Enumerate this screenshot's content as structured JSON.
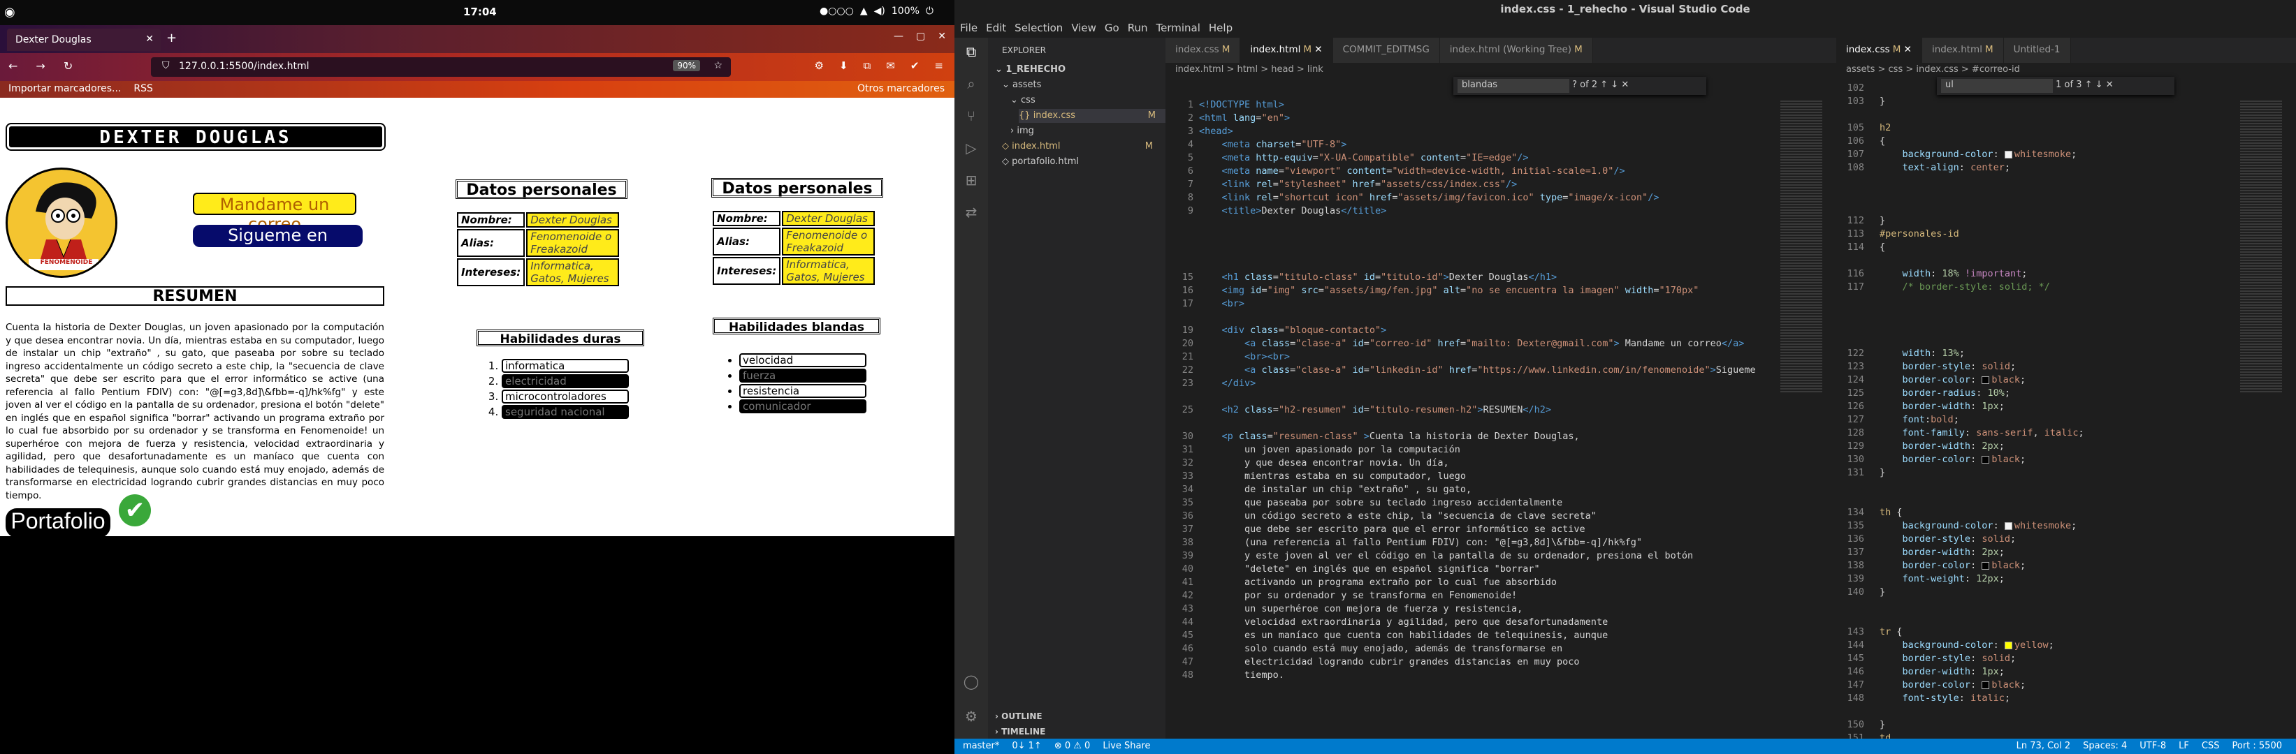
{
  "system": {
    "clock": "17:04",
    "battery": "100%"
  },
  "firefox": {
    "tab_title": "Dexter Douglas",
    "url": "127.0.0.1:5500/index.html",
    "url_host": "127.0.0.1",
    "url_rest": ":5500/index.html",
    "zoom": "90%",
    "bookmarks": {
      "import": "Importar marcadores...",
      "rss": "RSS",
      "other": "Otros marcadores"
    }
  },
  "page": {
    "title": "DEXTER DOUGLAS",
    "avatar_label": "FENOMENOIDE",
    "mail_btn": "Mandame un correo",
    "linkedin_btn": "Sigueme en Linkedin!",
    "resumen_h": "RESUMEN",
    "resumen_p": "Cuenta la historia de Dexter Douglas, un joven apasionado por la computación y que desea encontrar novia. Un día, mientras estaba en su computador, luego de instalar un chip \"extraño\" , su gato, que paseaba por sobre su teclado ingreso accidentalmente un código secreto a este chip, la \"secuencia de clave secreta\" que debe ser escrito para que el error informático se active (una referencia al fallo Pentium FDIV) con: \"@[=g3,8d]\\&fbb=-q]/hk%fg\" y este joven al ver el código en la pantalla de su ordenador, presiona el botón \"delete\" en inglés que en español significa \"borrar\" activando un programa extraño por lo cual fue absorbido por su ordenador y se transforma en Fenomenoide! un superhéroe con mejora de fuerza y resistencia, velocidad extraordinaria y agilidad, pero que desafortunadamente es un maníaco que cuenta con habilidades de telequinesis, aunque solo cuando está muy enojado, además de transformarse en electricidad logrando cubrir grandes distancias en muy poco tiempo.",
    "portafolio": "Portafolio",
    "datos_h": "Datos personales",
    "datos": [
      {
        "k": "Nombre:",
        "v": "Dexter Douglas"
      },
      {
        "k": "Alias:",
        "v": "Fenomenoide o Freakazoid"
      },
      {
        "k": "Intereses:",
        "v": "Informatica, Gatos, Mujeres"
      }
    ],
    "duras_h": "Habilidades duras",
    "duras": [
      "informatica",
      "electricidad",
      "microcontroladores",
      "seguridad nacional"
    ],
    "blandas_h": "Habilidades blandas",
    "blandas": [
      "velocidad",
      "fuerza",
      "resistencia",
      "comunicador"
    ]
  },
  "vscode": {
    "title": "index.css - 1_rehecho - Visual Studio Code",
    "menu": [
      "File",
      "Edit",
      "Selection",
      "View",
      "Go",
      "Run",
      "Terminal",
      "Help"
    ],
    "explorer_h": "EXPLORER",
    "tree": [
      {
        "label": "1_REHECHO",
        "mark": ""
      },
      {
        "label": "assets",
        "mark": ""
      },
      {
        "label": "css",
        "mark": ""
      },
      {
        "label": "index.css",
        "mark": "M"
      },
      {
        "label": "img",
        "mark": ""
      },
      {
        "label": "index.html",
        "mark": "M"
      },
      {
        "label": "portafolio.html",
        "mark": ""
      }
    ],
    "outline": "OUTLINE",
    "timeline": "TIMELINE",
    "tabs1": [
      {
        "label": "index.css",
        "m": "M"
      },
      {
        "label": "index.html",
        "m": "M"
      },
      {
        "label": "COMMIT_EDITMSG",
        "m": ""
      },
      {
        "label": "index.html (Working Tree)",
        "m": "M"
      }
    ],
    "crumb1": "index.html > html > head > link",
    "find1": {
      "text": "blandas",
      "count": "? of 2"
    },
    "tabs2": [
      {
        "label": "index.css",
        "m": "M"
      },
      {
        "label": "index.html",
        "m": "M"
      },
      {
        "label": "Untitled-1",
        "m": ""
      }
    ],
    "crumb2": "assets > css > index.css > #correo-id",
    "find2": {
      "text": "ul",
      "count": "1 of 3"
    },
    "status": {
      "branch": "master*",
      "sync": "0↓ 1↑",
      "problems": "⊗ 0 ⚠ 0",
      "share": "Live Share",
      "pos": "Ln 73, Col 2",
      "spaces": "Spaces: 4",
      "enc": "UTF-8",
      "eol": "LF",
      "lang": "CSS",
      "port": "Port : 5500"
    }
  }
}
